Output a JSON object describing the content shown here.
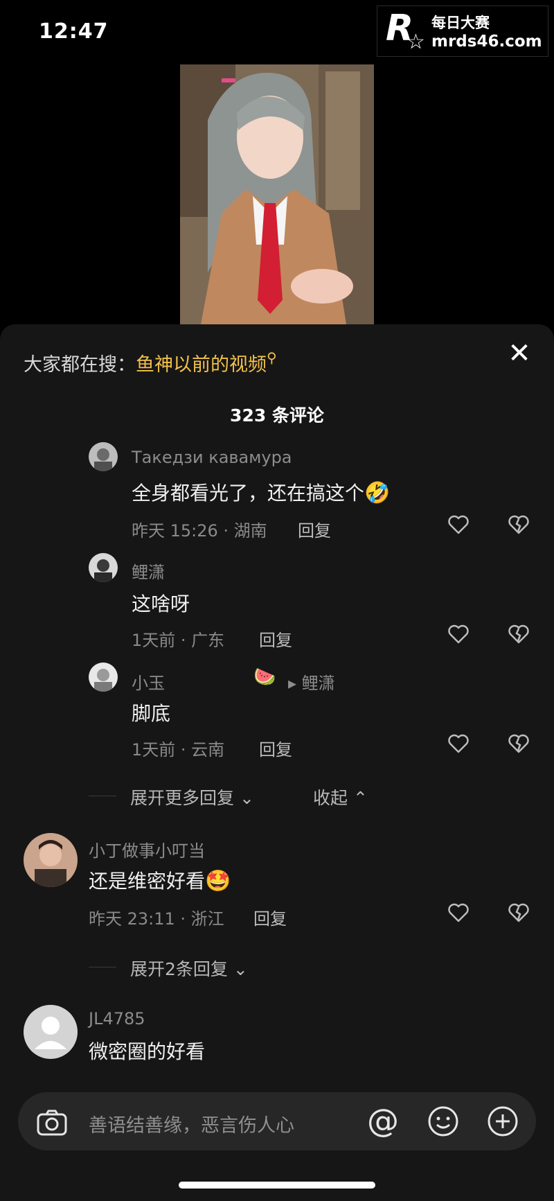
{
  "status_bar": {
    "time": "12:47"
  },
  "watermark": {
    "logo": "R",
    "line1": "每日大赛",
    "line2": "mrds46.com"
  },
  "search_hint": {
    "prefix": "大家都在搜：",
    "keyword": "鱼神以前的视频"
  },
  "comments_header": {
    "count_label": "323 条评论"
  },
  "comments": [
    {
      "name": "Такедзи кавамура",
      "text": "全身都看光了，还在搞这个",
      "emoji": "🤣",
      "meta": "昨天 15:26 · 湖南",
      "reply": "回复"
    },
    {
      "name": "鲤潇",
      "text": "这啥呀",
      "meta": "1天前 · 广东",
      "reply": "回复"
    },
    {
      "name": "小玉",
      "badge": "🍉",
      "reply_to": "▸ 鲤潇",
      "text": "脚底",
      "meta": "1天前 · 云南",
      "reply": "回复"
    },
    {
      "name": "小丁做事小叮当",
      "text": "还是维密好看",
      "emoji": "🤩",
      "meta": "昨天 23:11 · 浙江",
      "reply": "回复"
    },
    {
      "name": "JL4785",
      "text": "微密圈的好看"
    }
  ],
  "thread_controls": {
    "expand_more": "展开更多回复",
    "collapse": "收起",
    "expand_two": "展开2条回复"
  },
  "input_bar": {
    "placeholder": "善语结善缘，恶言伤人心"
  },
  "icons": [
    "close-icon",
    "search-icon",
    "heart-icon",
    "dislike-icon",
    "camera-icon",
    "at-icon",
    "emoji-icon",
    "plus-icon",
    "chevron-down-icon",
    "chevron-up-icon"
  ]
}
